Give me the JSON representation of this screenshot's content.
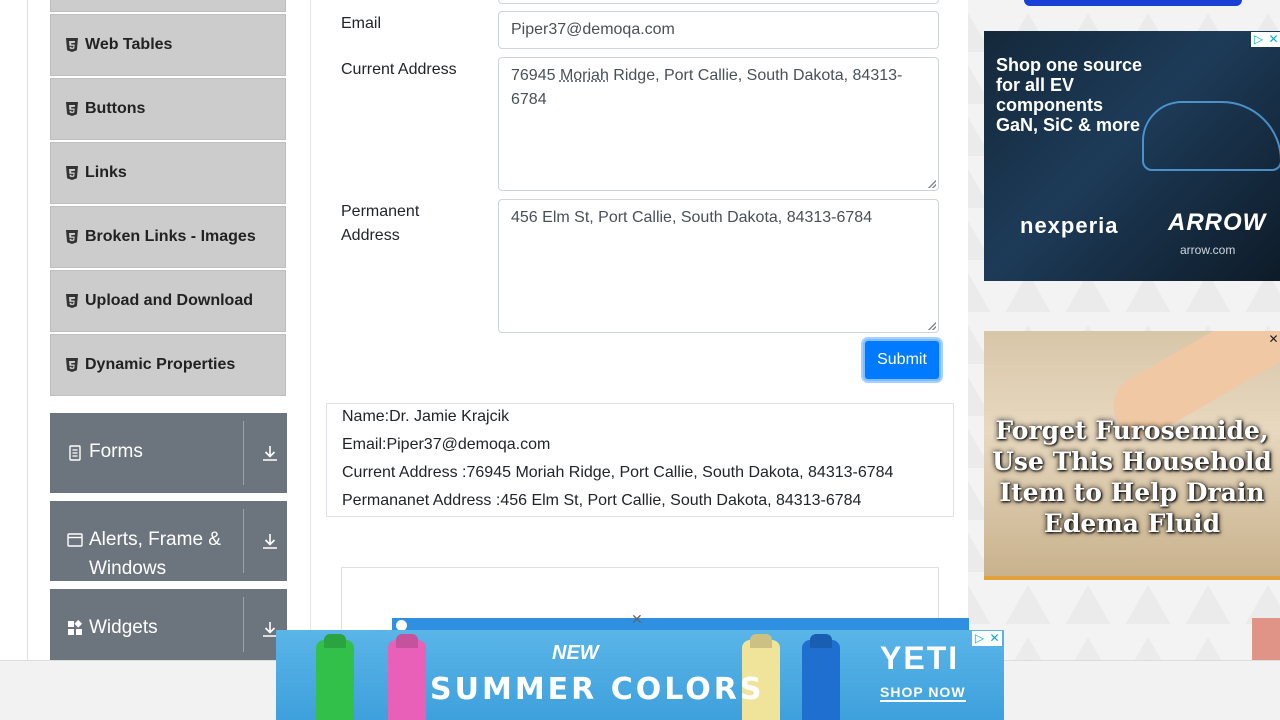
{
  "sidebar": {
    "sub_items": [
      {
        "label": ""
      },
      {
        "label": "Web Tables"
      },
      {
        "label": "Buttons"
      },
      {
        "label": "Links"
      },
      {
        "label": "Broken Links - Images"
      },
      {
        "label": "Upload and Download"
      },
      {
        "label": "Dynamic Properties"
      }
    ],
    "groups": [
      {
        "label": "Forms",
        "icon": "form-icon"
      },
      {
        "label": "Alerts, Frame & Windows",
        "icon": "window-icon"
      },
      {
        "label": "Widgets",
        "icon": "widgets-icon"
      }
    ]
  },
  "form": {
    "email_label": "Email",
    "email_value": "Piper37@demoqa.com",
    "current_address_label": "Current Address",
    "current_address_prefix": "76945 ",
    "current_address_underlined": "Moriah",
    "current_address_rest": " Ridge, Port Callie, South Dakota, 84313-6784",
    "permanent_address_label": "Permanent Address",
    "permanent_address_value": "456 Elm St, Port Callie, South Dakota, 84313-6784",
    "submit_label": "Submit"
  },
  "output": {
    "name": "Name:Dr. Jamie Krajcik",
    "email": "Email:Piper37@demoqa.com",
    "current_address": "Current Address :76945 Moriah Ridge, Port Callie, South Dakota, 84313-6784",
    "permanent_address": "Permananet Address :456 Elm St, Port Callie, South Dakota, 84313-6784"
  },
  "ads": {
    "ad1": {
      "headline": "Shop one source for all EV components GaN, SiC & more",
      "brand_left": "nexperia",
      "brand_right": "ARROW",
      "url": "arrow.com"
    },
    "ad2": {
      "headline": "Forget Furosemide, Use This Household Item to Help Drain Edema Fluid"
    },
    "bottom": {
      "new_label": "NEW",
      "title": "SUMMER COLORS",
      "brand": "YETI",
      "cta": "SHOP NOW"
    },
    "close_glyph": "✕",
    "adchoices_glyph": "▷"
  },
  "colors": {
    "primary": "#007bff",
    "sidebar_group": "#6c757d",
    "sidebar_item": "#cccccc"
  }
}
